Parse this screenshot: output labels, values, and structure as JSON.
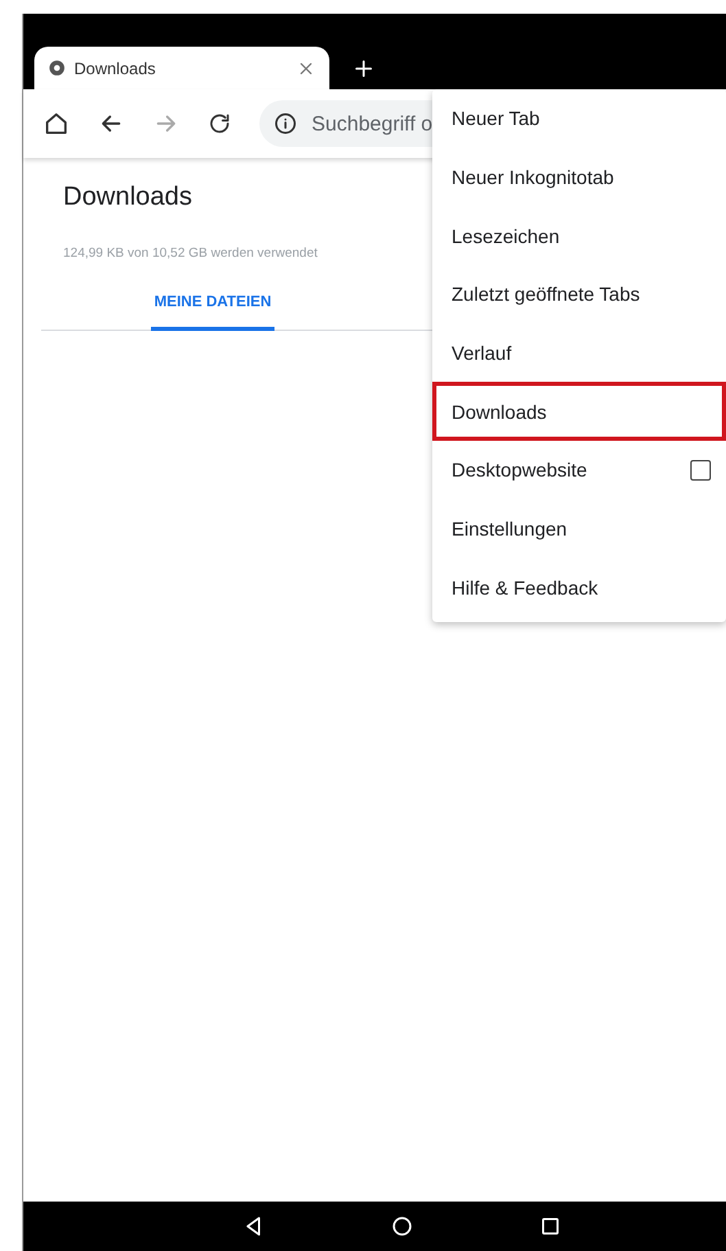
{
  "tabs": [
    {
      "title": "Downloads",
      "selected": true
    }
  ],
  "toolbar": {
    "address_placeholder": "Suchbegriff o",
    "forward_disabled": true
  },
  "page": {
    "title": "Downloads",
    "storage": "124,99 KB von 10,52 GB werden verwendet",
    "tabs": [
      {
        "label": "MEINE DATEIEN",
        "selected": true
      }
    ]
  },
  "menu": {
    "items": [
      {
        "label": "Neuer Tab",
        "kind": "plain",
        "highlighted": false
      },
      {
        "label": "Neuer Inkognitotab",
        "kind": "plain",
        "highlighted": false
      },
      {
        "label": "Lesezeichen",
        "kind": "plain",
        "highlighted": false
      },
      {
        "label": "Zuletzt geöffnete Tabs",
        "kind": "plain",
        "highlighted": false
      },
      {
        "label": "Verlauf",
        "kind": "plain",
        "highlighted": false
      },
      {
        "label": "Downloads",
        "kind": "plain",
        "highlighted": true
      },
      {
        "label": "Desktopwebsite",
        "kind": "checkbox",
        "checked": false,
        "highlighted": false
      },
      {
        "label": "Einstellungen",
        "kind": "plain",
        "highlighted": false
      },
      {
        "label": "Hilfe & Feedback",
        "kind": "plain",
        "highlighted": false
      }
    ]
  }
}
